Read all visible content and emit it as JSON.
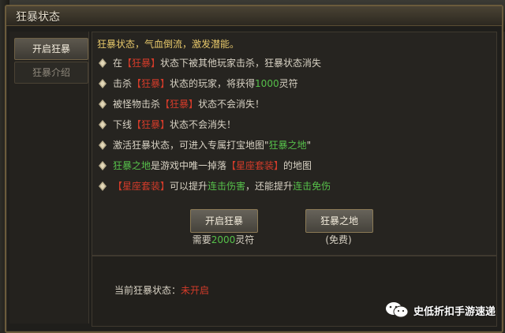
{
  "window": {
    "title": "狂暴状态",
    "close_label": "×"
  },
  "sidebar": {
    "tabs": [
      {
        "label": "开启狂暴",
        "active": true
      },
      {
        "label": "狂暴介绍",
        "active": false
      }
    ]
  },
  "content": {
    "intro": "狂暴状态，气血倒流，激发潜能。",
    "lines": [
      {
        "parts": [
          {
            "text": "在",
            "color": "norm"
          },
          {
            "text": "【狂暴】",
            "color": "red"
          },
          {
            "text": "状态下被其他玩家击杀，狂暴状态消失",
            "color": "norm"
          }
        ]
      },
      {
        "parts": [
          {
            "text": "击杀",
            "color": "norm"
          },
          {
            "text": "【狂暴】",
            "color": "red"
          },
          {
            "text": "状态的玩家，将获得",
            "color": "norm"
          },
          {
            "text": "1000",
            "color": "green"
          },
          {
            "text": "灵符",
            "color": "norm"
          }
        ]
      },
      {
        "parts": [
          {
            "text": "被怪物击杀",
            "color": "norm"
          },
          {
            "text": "【狂暴】",
            "color": "red"
          },
          {
            "text": "状态不会消失！",
            "color": "norm"
          }
        ]
      },
      {
        "parts": [
          {
            "text": "下线",
            "color": "norm"
          },
          {
            "text": "【狂暴】",
            "color": "red"
          },
          {
            "text": "状态不会消失！",
            "color": "norm"
          }
        ]
      },
      {
        "parts": [
          {
            "text": "激活狂暴状态，可进入专属打宝地图",
            "color": "norm"
          },
          {
            "text": "\"",
            "color": "norm"
          },
          {
            "text": "狂暴之地",
            "color": "green"
          },
          {
            "text": "\"",
            "color": "norm"
          }
        ]
      },
      {
        "parts": [
          {
            "text": "狂暴之地",
            "color": "green"
          },
          {
            "text": "是游戏中唯一掉落",
            "color": "norm"
          },
          {
            "text": "【星座套装】",
            "color": "red"
          },
          {
            "text": "的地图",
            "color": "norm"
          }
        ]
      },
      {
        "parts": [
          {
            "text": "【星座套装】",
            "color": "red"
          },
          {
            "text": "可以提升",
            "color": "norm"
          },
          {
            "text": "连击伤害",
            "color": "green"
          },
          {
            "text": "，还能提升",
            "color": "norm"
          },
          {
            "text": "连击免伤",
            "color": "green"
          }
        ]
      }
    ],
    "buttons": {
      "activate": {
        "label": "开启狂暴",
        "note_prefix": "需要",
        "note_value": "2000",
        "note_suffix": "灵符"
      },
      "map": {
        "label": "狂暴之地",
        "note": "(免费)"
      }
    }
  },
  "status": {
    "label": "当前狂暴状态：",
    "value": "未开启"
  },
  "watermark": {
    "text": "史低折扣手游速递",
    "icon": "wechat-icon"
  },
  "colors": {
    "red": "#d33b2a",
    "green": "#56c04a",
    "norm": "#d8d2c4",
    "gold": "#e7c86a"
  }
}
